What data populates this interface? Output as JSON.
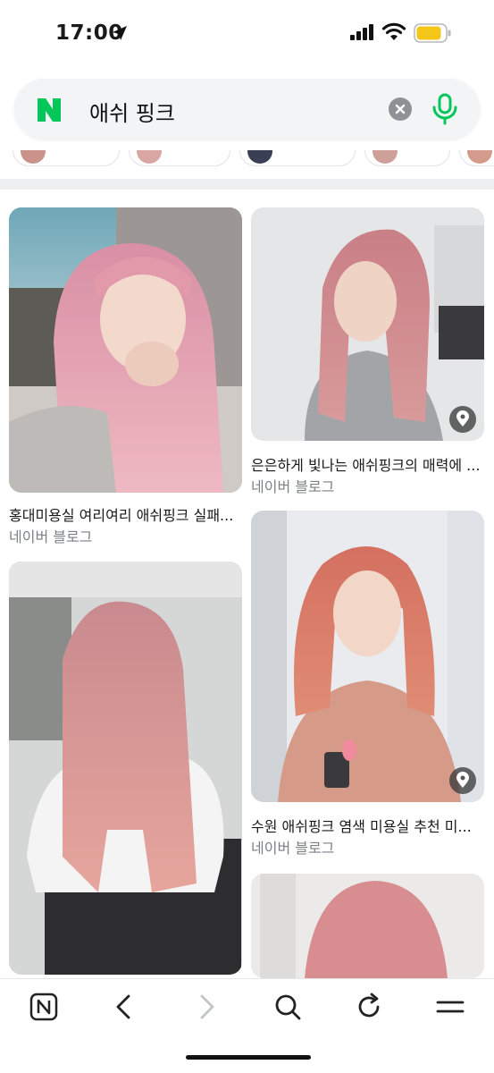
{
  "status": {
    "time": "17:00"
  },
  "search": {
    "query": "애쉬 핑크",
    "logo_letter": "N",
    "brand_color": "#03c75a"
  },
  "results": [
    {
      "title": "홍대미용실 여리여리 애쉬핑크 실패...",
      "source": "네이버 블로그"
    },
    {
      "title": "은은하게 빛나는 애쉬핑크의 매력에 ...",
      "source": "네이버 블로그"
    },
    {
      "title": "수원 애쉬핑크 염색 미용실 추천 미...",
      "source": "네이버 블로그"
    }
  ],
  "toolbar": {
    "items": [
      "naver-home-icon",
      "back-icon",
      "forward-icon",
      "search-icon",
      "refresh-icon",
      "menu-icon"
    ]
  }
}
